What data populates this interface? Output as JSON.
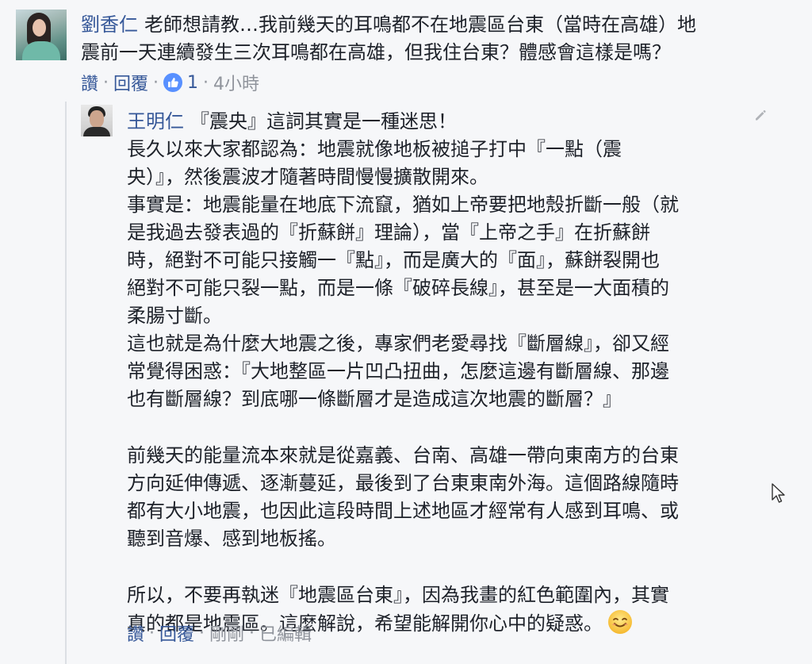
{
  "comment": {
    "author": "劉香仁",
    "text_line1": "老師想請教…我前幾天的耳鳴都不在地震區台東（當時在高雄）地",
    "text_line2": "震前一天連續發生三次耳鳴都在高雄，但我住台東？體感會這樣是嗎？",
    "actions": {
      "like": "讚",
      "sep": "·",
      "reply": "回覆",
      "like_count": "1",
      "time": "4小時"
    }
  },
  "reply": {
    "author": "王明仁",
    "first_line": "『震央』這詞其實是一種迷思！",
    "paragraph1": [
      "長久以來大家都認為：地震就像地板被搥子打中『一點（震",
      "央）』，然後震波才隨著時間慢慢擴散開來。",
      "事實是：地震能量在地底下流竄，猶如上帝要把地殼折斷一般（就",
      "是我過去發表過的『折蘇餅』理論），當『上帝之手』在折蘇餅",
      "時，絕對不可能只接觸一『點』，而是廣大的『面』，蘇餅裂開也",
      "絕對不可能只裂一點，而是一條『破碎長線』，甚至是一大面積的",
      "柔腸寸斷。",
      "這也就是為什麼大地震之後，專家們老愛尋找『斷層線』，卻又經",
      "常覺得困惑：『大地整區一片凹凸扭曲，怎麼這邊有斷層線、那邊",
      "也有斷層線？到底哪一條斷層才是造成這次地震的斷層？』"
    ],
    "paragraph2": [
      "前幾天的能量流本來就是從嘉義、台南、高雄一帶向東南方的台東",
      "方向延伸傳遞、逐漸蔓延，最後到了台東東南外海。這個路線隨時",
      "都有大小地震，也因此這段時間上述地區才經常有人感到耳鳴、或",
      "聽到音爆、感到地板搖。"
    ],
    "paragraph3": [
      "所以，不要再執迷『地震區台東』，因為我畫的紅色範圍內，其實",
      "真的都是地震區。這麼解說，希望能解開你心中的疑惑。"
    ],
    "emoji": "smiling-face-icon",
    "actions": {
      "like": "讚",
      "sep": "·",
      "reply": "回覆",
      "time": "剛剛",
      "edited": "已編輯"
    }
  },
  "colors": {
    "link": "#365899",
    "meta": "#90949c",
    "text": "#1d2129",
    "like_badge": "#5890ff",
    "background": "#f6f7f9"
  }
}
